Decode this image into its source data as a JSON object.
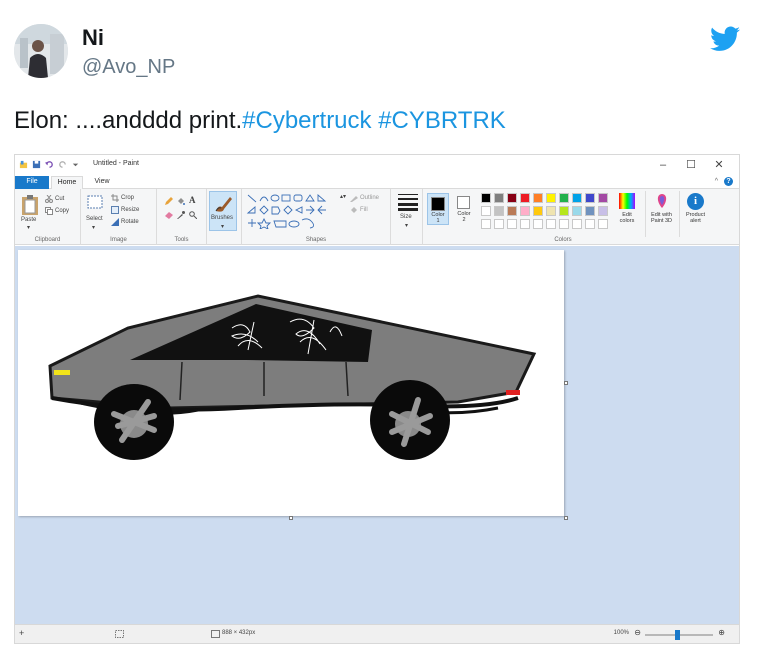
{
  "tweet": {
    "display_name": "Ni",
    "handle": "@Avo_NP",
    "text_plain": "Elon: ....andddd print.",
    "hashtag_1": "#Cybertruck",
    "hashtag_2": "#CYBRTRK"
  },
  "paint": {
    "window_title": "Untitled - Paint",
    "tabs": {
      "file": "File",
      "home": "Home",
      "view": "View"
    },
    "clipboard": {
      "paste": "Paste",
      "cut": "Cut",
      "copy": "Copy",
      "label": "Clipboard"
    },
    "image": {
      "select": "Select",
      "crop": "Crop",
      "resize": "Resize",
      "rotate": "Rotate",
      "label": "Image"
    },
    "tools": {
      "label": "Tools",
      "text_tool": "A"
    },
    "brushes": {
      "label": "Brushes"
    },
    "shapes": {
      "outline": "Outline",
      "fill": "Fill",
      "label": "Shapes"
    },
    "size": {
      "label": "Size"
    },
    "color1": {
      "label_a": "Color",
      "label_b": "1"
    },
    "color2": {
      "label_a": "Color",
      "label_b": "2"
    },
    "colors_label": "Colors",
    "edit_colors": {
      "a": "Edit",
      "b": "colors"
    },
    "edit_paint3d": {
      "a": "Edit with",
      "b": "Paint 3D"
    },
    "product_alert": {
      "a": "Product",
      "b": "alert"
    },
    "status": {
      "dimensions": "888 × 432px",
      "zoom": "100%"
    },
    "colors": {
      "accent": "#1979ca",
      "primary_color": "#000000",
      "secondary_color": "#ffffff",
      "palette_row1": [
        "#000000",
        "#7f7f7f",
        "#880015",
        "#ed1c24",
        "#ff7f27",
        "#fff200",
        "#22b14c",
        "#00a2e8",
        "#3f48cc",
        "#a349a4"
      ],
      "palette_row2": [
        "#ffffff",
        "#c3c3c3",
        "#b97a57",
        "#ffaec9",
        "#ffc90e",
        "#efe4b0",
        "#b5e61d",
        "#99d9ea",
        "#7092be",
        "#c8bfe7"
      ]
    }
  }
}
